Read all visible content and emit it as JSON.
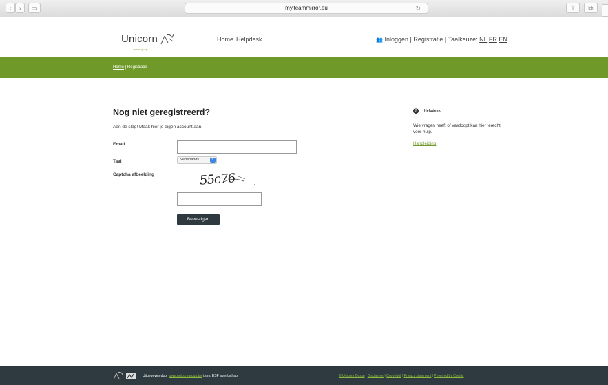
{
  "browser": {
    "url": "my.teammirror.eu",
    "back": "‹",
    "forward": "›"
  },
  "header": {
    "logo_text": "Unicorn",
    "logo_tagline": "unicorn group",
    "nav": [
      "Home",
      "Helpdesk"
    ],
    "login": "Inloggen",
    "register": "Registratie",
    "lang_label": "Taalkeuze:",
    "langs": [
      "NL",
      "FR",
      "EN"
    ]
  },
  "breadcrumb": {
    "home": "Home",
    "separator": "|",
    "current": "Registratie"
  },
  "form": {
    "title": "Nog niet geregistreerd?",
    "intro": "Aan de slag! Maak hier je eigen account aan.",
    "email_label": "Email",
    "email_value": "",
    "language_label": "Taal",
    "language_value": "Nederlands",
    "captcha_label": "Captcha afbeelding",
    "captcha_text": "55c76",
    "captcha_value": "",
    "submit": "Bevestigen"
  },
  "sidebar": {
    "title": "Helpdesk",
    "text": "Wie vragen heeft of vastloopt kan hier terecht voor hulp.",
    "link": "Handleiding"
  },
  "footer": {
    "published_by": "Uitgegeven door",
    "site": "www.unicorngroup.be",
    "suffix": "i.s.m. ESF agentschap",
    "links": [
      "© Unicorn Group",
      "Disclaimer",
      "Copyright",
      "Privacy statement",
      "Powered by Codific"
    ]
  },
  "colors": {
    "green": "#6f9a2a",
    "footer": "#2e3a3f",
    "button": "#2f3a40"
  }
}
